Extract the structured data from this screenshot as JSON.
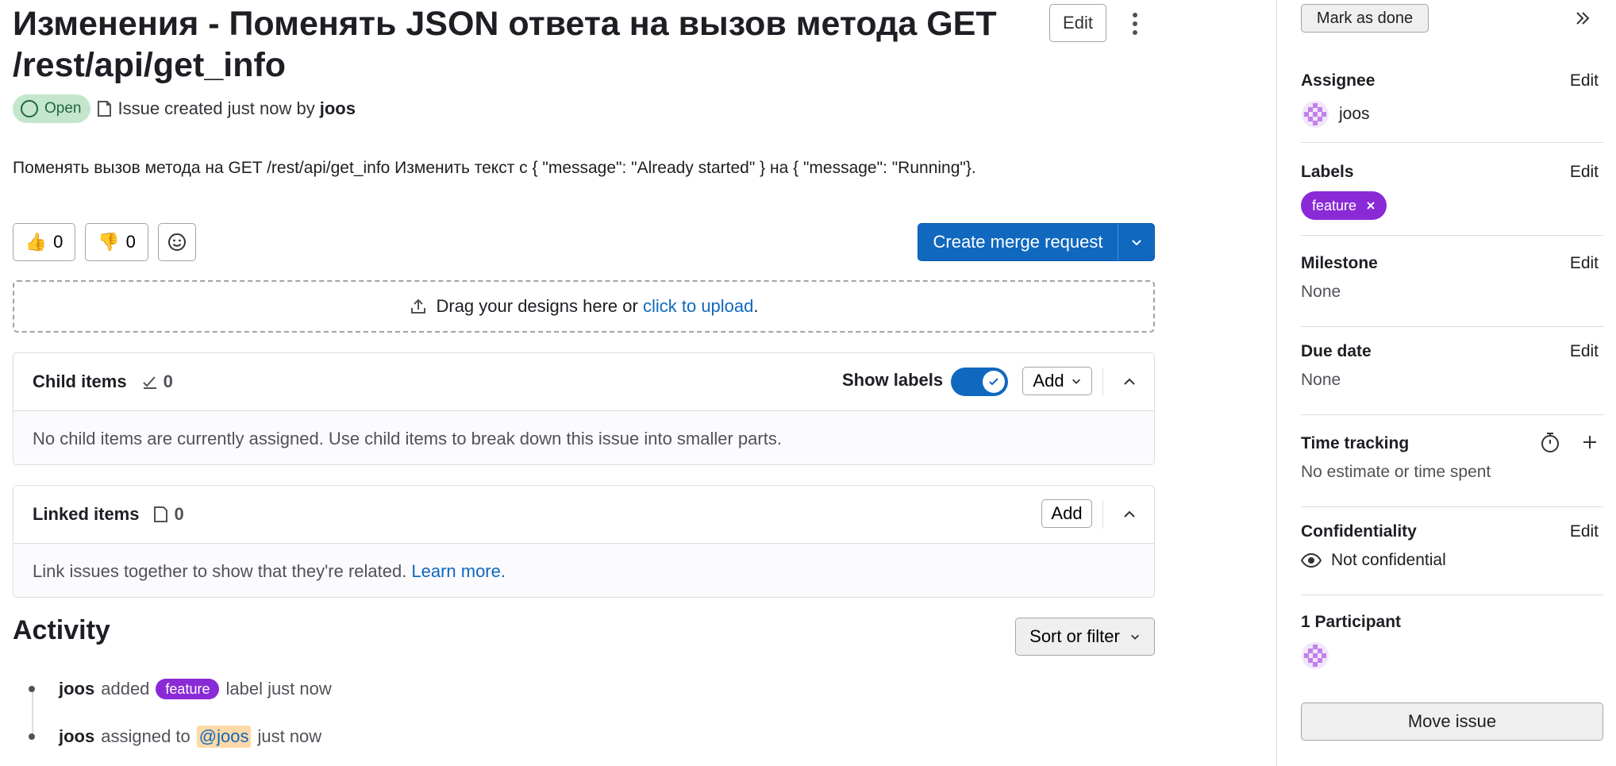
{
  "issue": {
    "title": "Изменения - Поменять JSON ответа на вызов метода GET /rest/api/get_info",
    "edit_label": "Edit",
    "status": "Open",
    "created_text": "Issue created just now by",
    "author": "joos",
    "description": "Поменять вызов метода на GET /rest/api/get_info Изменить текст с { \"message\": \"Already started\" } на { \"message\": \"Running\"}."
  },
  "reactions": {
    "thumbs_up_count": "0",
    "thumbs_down_count": "0"
  },
  "merge": {
    "label": "Create merge request"
  },
  "dropzone": {
    "text": "Drag your designs here or",
    "link": "click to upload",
    "suffix": "."
  },
  "child_items": {
    "title": "Child items",
    "count": "0",
    "show_labels": "Show labels",
    "add_label": "Add",
    "empty_text": "No child items are currently assigned. Use child items to break down this issue into smaller parts."
  },
  "linked_items": {
    "title": "Linked items",
    "count": "0",
    "add_label": "Add",
    "empty_text": "Link issues together to show that they're related.",
    "learn_more": "Learn more."
  },
  "activity": {
    "title": "Activity",
    "sort_label": "Sort or filter",
    "items": [
      {
        "user": "joos",
        "pre": "added",
        "label": "feature",
        "post": "label just now"
      },
      {
        "user": "joos",
        "pre": "assigned to",
        "mention": "@joos",
        "post": "just now"
      }
    ]
  },
  "sidebar": {
    "mark_done": "Mark as done",
    "edit_label": "Edit",
    "assignee": {
      "title": "Assignee",
      "value": "joos"
    },
    "labels": {
      "title": "Labels",
      "value": "feature"
    },
    "milestone": {
      "title": "Milestone",
      "value": "None"
    },
    "due_date": {
      "title": "Due date",
      "value": "None"
    },
    "time_tracking": {
      "title": "Time tracking",
      "value": "No estimate or time spent"
    },
    "confidentiality": {
      "title": "Confidentiality",
      "value": "Not confidential"
    },
    "participants": {
      "title": "1 Participant"
    },
    "move_issue": "Move issue"
  },
  "colors": {
    "primary": "#1068bf",
    "label_feature": "#8a2ad7",
    "status_open_bg": "#c3e6cd",
    "status_open_fg": "#24663b",
    "mention_bg": "#fdd9a7"
  },
  "icons": [
    "kebab-icon",
    "open-status-icon",
    "issue-type-icon",
    "thumbs-up-icon",
    "thumbs-down-icon",
    "emoji-add-icon",
    "chevron-down-icon",
    "upload-icon",
    "child-items-icon",
    "check-icon",
    "chevron-up-icon",
    "linked-items-icon",
    "expand-sidebar-icon",
    "avatar-icon",
    "close-icon",
    "timer-icon",
    "plus-icon",
    "eye-icon"
  ]
}
